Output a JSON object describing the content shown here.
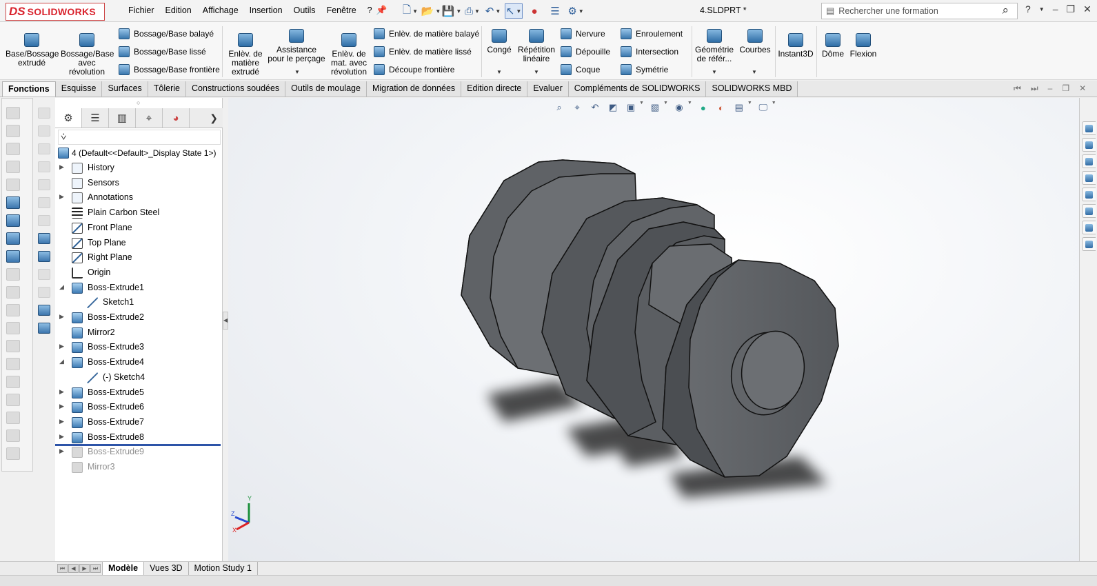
{
  "app": {
    "logo_ds": "DS",
    "logo_text": "SOLIDWORKS",
    "document_title": "4.SLDPRT *"
  },
  "menu": [
    "Fichier",
    "Edition",
    "Affichage",
    "Insertion",
    "Outils",
    "Fenêtre",
    "?"
  ],
  "search": {
    "placeholder": "Rechercher une formation"
  },
  "ribbon": {
    "extruded_boss": "Base/Bossage extrudé",
    "revolved_boss": "Bossage/Base avec révolution",
    "swept_boss": "Bossage/Base balayé",
    "lofted_boss": "Bossage/Base lissé",
    "boundary_boss": "Bossage/Base frontière",
    "extruded_cut": "Enlèv. de matière extrudé",
    "hole_wizard": "Assistance pour le perçage",
    "revolved_cut": "Enlèv. de mat. avec révolution",
    "swept_cut": "Enlèv. de matière balayé",
    "lofted_cut": "Enlèv. de matière lissé",
    "boundary_cut": "Découpe frontière",
    "fillet": "Congé",
    "linear_pattern": "Répétition linéaire",
    "rib": "Nervure",
    "draft": "Dépouille",
    "shell": "Coque",
    "wrap": "Enroulement",
    "intersect": "Intersection",
    "mirror": "Symétrie",
    "ref_geometry": "Géométrie de référ...",
    "curves": "Courbes",
    "instant3d": "Instant3D",
    "dome": "Dôme",
    "flex": "Flexion"
  },
  "tabs": [
    "Fonctions",
    "Esquisse",
    "Surfaces",
    "Tôlerie",
    "Constructions soudées",
    "Outils de moulage",
    "Migration de données",
    "Edition directe",
    "Evaluer",
    "Compléments de SOLIDWORKS",
    "SOLIDWORKS MBD"
  ],
  "feature_tree": {
    "root": "4  (Default<<Default>_Display State 1>)",
    "items": [
      {
        "label": "History",
        "icon": "history-folder-icon",
        "expander": "right",
        "indent": 0
      },
      {
        "label": "Sensors",
        "icon": "sensors-folder-icon",
        "expander": "",
        "indent": 0
      },
      {
        "label": "Annotations",
        "icon": "annotations-folder-icon",
        "expander": "right",
        "indent": 0
      },
      {
        "label": "Plain Carbon Steel",
        "icon": "material-icon",
        "expander": "",
        "indent": 0
      },
      {
        "label": "Front Plane",
        "icon": "plane-icon",
        "expander": "",
        "indent": 0
      },
      {
        "label": "Top Plane",
        "icon": "plane-icon",
        "expander": "",
        "indent": 0
      },
      {
        "label": "Right Plane",
        "icon": "plane-icon",
        "expander": "",
        "indent": 0
      },
      {
        "label": "Origin",
        "icon": "origin-icon",
        "expander": "",
        "indent": 0
      },
      {
        "label": "Boss-Extrude1",
        "icon": "extrude-icon",
        "expander": "down",
        "indent": 0
      },
      {
        "label": "Sketch1",
        "icon": "sketch-icon",
        "expander": "",
        "indent": 1
      },
      {
        "label": "Boss-Extrude2",
        "icon": "extrude-icon",
        "expander": "right",
        "indent": 0
      },
      {
        "label": "Mirror2",
        "icon": "mirror-icon",
        "expander": "",
        "indent": 0
      },
      {
        "label": "Boss-Extrude3",
        "icon": "extrude-icon",
        "expander": "right",
        "indent": 0
      },
      {
        "label": "Boss-Extrude4",
        "icon": "extrude-icon",
        "expander": "down",
        "indent": 0
      },
      {
        "label": "(-) Sketch4",
        "icon": "sketch-icon",
        "expander": "",
        "indent": 1
      },
      {
        "label": "Boss-Extrude5",
        "icon": "extrude-icon",
        "expander": "right",
        "indent": 0
      },
      {
        "label": "Boss-Extrude6",
        "icon": "extrude-icon",
        "expander": "right",
        "indent": 0
      },
      {
        "label": "Boss-Extrude7",
        "icon": "extrude-icon",
        "expander": "right",
        "indent": 0
      },
      {
        "label": "Boss-Extrude8",
        "icon": "extrude-icon",
        "expander": "right",
        "indent": 0
      },
      {
        "label": "Boss-Extrude9",
        "icon": "extrude-icon",
        "expander": "right",
        "indent": 0,
        "suppressed": true
      },
      {
        "label": "Mirror3",
        "icon": "mirror-icon",
        "expander": "",
        "indent": 0,
        "suppressed": true
      }
    ]
  },
  "triad": {
    "x": "X",
    "y": "Y",
    "z": "Z"
  },
  "bottom_tabs": [
    "Modèle",
    "Vues 3D",
    "Motion Study 1"
  ],
  "colors": {
    "brand_red": "#d9232d",
    "accent_blue": "#2d54a8",
    "part_gray": "#5e6165"
  }
}
